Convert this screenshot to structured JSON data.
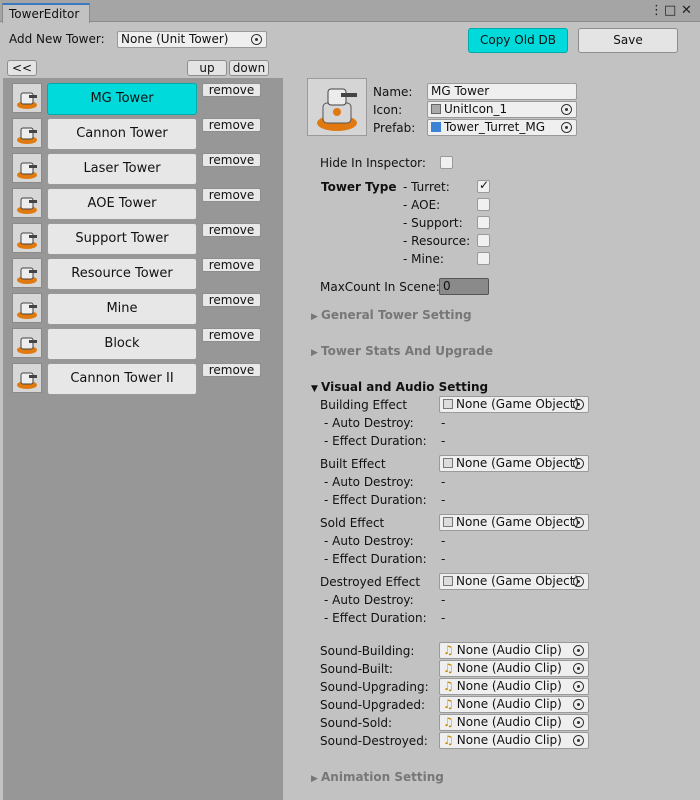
{
  "window": {
    "tab_title": "TowerEditor",
    "menu_icon": "kebab-menu-icon",
    "maximize_icon": "maximize-icon",
    "close_icon": "close-icon"
  },
  "toolbar": {
    "add_label": "Add New Tower:",
    "add_value": "None (Unit Tower)",
    "copy_label": "Copy Old DB",
    "save_label": "Save",
    "collapse_label": "<<",
    "up_label": "up",
    "down_label": "down"
  },
  "towers": [
    {
      "name": "MG Tower",
      "remove": "remove",
      "selected": true,
      "icon": "mg-tower-icon"
    },
    {
      "name": "Cannon Tower",
      "remove": "remove",
      "icon": "cannon-tower-icon"
    },
    {
      "name": "Laser Tower",
      "remove": "remove",
      "icon": "laser-tower-icon"
    },
    {
      "name": "AOE Tower",
      "remove": "remove",
      "icon": "aoe-tower-icon"
    },
    {
      "name": "Support Tower",
      "remove": "remove",
      "icon": "support-tower-icon"
    },
    {
      "name": "Resource Tower",
      "remove": "remove",
      "icon": "resource-tower-icon"
    },
    {
      "name": "Mine",
      "remove": "remove",
      "icon": "mine-icon"
    },
    {
      "name": "Block",
      "remove": "remove",
      "icon": "block-icon"
    },
    {
      "name": "Cannon Tower II",
      "remove": "remove",
      "icon": "cannon-tower-ii-icon"
    }
  ],
  "detail": {
    "name_label": "Name:",
    "name_value": "MG Tower",
    "icon_label": "Icon:",
    "icon_value": "UnitIcon_1",
    "prefab_label": "Prefab:",
    "prefab_value": "Tower_Turret_MG",
    "hide_label": "Hide In Inspector:",
    "type_label": "Tower Type",
    "types": [
      {
        "label": "- Turret:",
        "checked": true
      },
      {
        "label": "- AOE:",
        "checked": false
      },
      {
        "label": "- Support:",
        "checked": false
      },
      {
        "label": "- Resource:",
        "checked": false
      },
      {
        "label": "- Mine:",
        "checked": false
      }
    ],
    "maxcount_label": "MaxCount In Scene:",
    "maxcount_value": "0",
    "general_fold": "General Tower Setting",
    "stats_fold": "Tower Stats And Upgrade",
    "visual_fold": "Visual and Audio Setting",
    "animation_fold": "Animation Setting"
  },
  "effects": [
    {
      "label": "Building Effect",
      "value": "None (Game Object)",
      "auto_label": "- Auto Destroy:",
      "auto_value": "-",
      "dur_label": "- Effect Duration:",
      "dur_value": "-"
    },
    {
      "label": "Built Effect",
      "value": "None (Game Object)",
      "auto_label": "- Auto Destroy:",
      "auto_value": "-",
      "dur_label": "- Effect Duration:",
      "dur_value": "-"
    },
    {
      "label": "Sold Effect",
      "value": "None (Game Object)",
      "auto_label": "- Auto Destroy:",
      "auto_value": "-",
      "dur_label": "- Effect Duration:",
      "dur_value": "-"
    },
    {
      "label": "Destroyed Effect",
      "value": "None (Game Object)",
      "auto_label": "- Auto Destroy:",
      "auto_value": "-",
      "dur_label": "- Effect Duration:",
      "dur_value": "-"
    }
  ],
  "sounds": [
    {
      "label": "Sound-Building:",
      "value": "None (Audio Clip)"
    },
    {
      "label": "Sound-Built:",
      "value": "None (Audio Clip)"
    },
    {
      "label": "Sound-Upgrading:",
      "value": "None (Audio Clip)"
    },
    {
      "label": "Sound-Upgraded:",
      "value": "None (Audio Clip)"
    },
    {
      "label": "Sound-Sold:",
      "value": "None (Audio Clip)"
    },
    {
      "label": "Sound-Destroyed:",
      "value": "None (Audio Clip)"
    }
  ]
}
